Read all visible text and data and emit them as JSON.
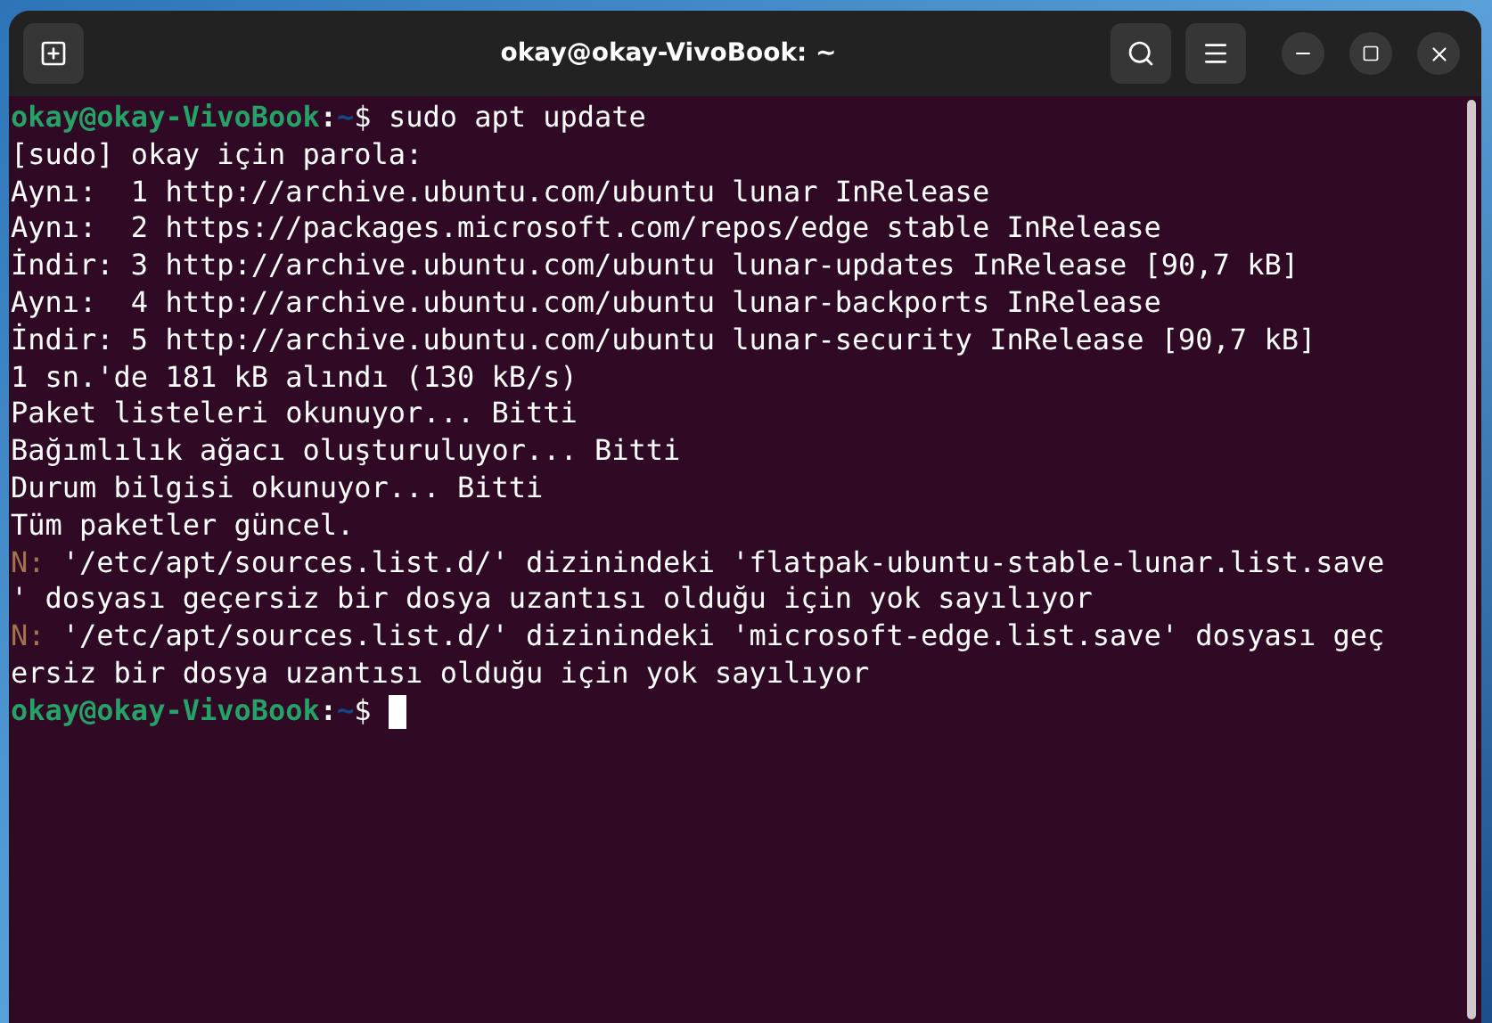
{
  "window": {
    "title": "okay@okay-VivoBook: ~"
  },
  "lines": [
    {
      "kind": "prompt",
      "user": "okay@okay-VivoBook",
      "sep": ":",
      "path": "~",
      "symbol": "$",
      "command": " sudo apt update",
      "cursor": false
    },
    {
      "kind": "output",
      "text": "[sudo] okay için parola:"
    },
    {
      "kind": "output",
      "text": "Aynı:  1 http://archive.ubuntu.com/ubuntu lunar InRelease"
    },
    {
      "kind": "output",
      "text": "Aynı:  2 https://packages.microsoft.com/repos/edge stable InRelease"
    },
    {
      "kind": "output",
      "text": "İndir: 3 http://archive.ubuntu.com/ubuntu lunar-updates InRelease [90,7 kB]"
    },
    {
      "kind": "output",
      "text": "Aynı:  4 http://archive.ubuntu.com/ubuntu lunar-backports InRelease"
    },
    {
      "kind": "output",
      "text": "İndir: 5 http://archive.ubuntu.com/ubuntu lunar-security InRelease [90,7 kB]"
    },
    {
      "kind": "output",
      "text": "1 sn.'de 181 kB alındı (130 kB/s)"
    },
    {
      "kind": "output",
      "text": "Paket listeleri okunuyor... Bitti"
    },
    {
      "kind": "output",
      "text": "Bağımlılık ağacı oluşturuluyor... Bitti"
    },
    {
      "kind": "output",
      "text": "Durum bilgisi okunuyor... Bitti"
    },
    {
      "kind": "output",
      "text": "Tüm paketler güncel."
    },
    {
      "kind": "notice",
      "prefix": "N:",
      "text": " '/etc/apt/sources.list.d/' dizinindeki 'flatpak-ubuntu-stable-lunar.list.save"
    },
    {
      "kind": "output",
      "text": "' dosyası geçersiz bir dosya uzantısı olduğu için yok sayılıyor"
    },
    {
      "kind": "notice",
      "prefix": "N:",
      "text": " '/etc/apt/sources.list.d/' dizinindeki 'microsoft-edge.list.save' dosyası geç"
    },
    {
      "kind": "output",
      "text": "ersiz bir dosya uzantısı olduğu için yok sayılıyor"
    },
    {
      "kind": "prompt",
      "user": "okay@okay-VivoBook",
      "sep": ":",
      "path": "~",
      "symbol": "$",
      "cursor": true
    }
  ]
}
